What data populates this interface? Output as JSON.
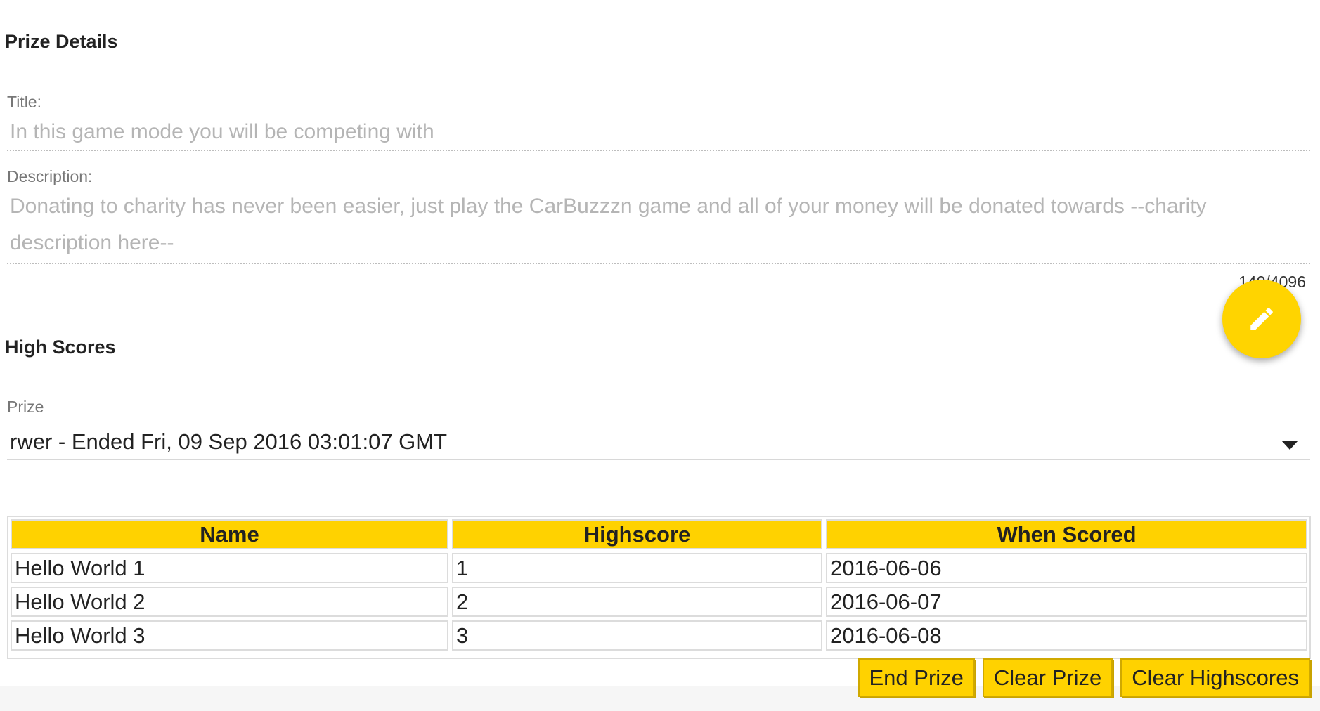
{
  "prize_details": {
    "heading": "Prize Details",
    "title_label": "Title:",
    "title_value": "In this game mode you will be competing with",
    "description_label": "Description:",
    "description_value": "Donating to charity has never been easier, just play the CarBuzzzn game and all of your money will be donated towards --charity description here--",
    "char_counter": "140/4096",
    "edit_icon": "pencil-icon",
    "accent_color": "#ffd400"
  },
  "high_scores": {
    "heading": "High Scores",
    "prize_label": "Prize",
    "prize_selected": "rwer - Ended Fri, 09 Sep 2016 03:01:07 GMT",
    "table": {
      "headers": [
        "Name",
        "Highscore",
        "When Scored"
      ],
      "rows": [
        [
          "Hello World 1",
          "1",
          "2016-06-06"
        ],
        [
          "Hello World 2",
          "2",
          "2016-06-07"
        ],
        [
          "Hello World 3",
          "3",
          "2016-06-08"
        ]
      ]
    },
    "buttons": {
      "end_prize": "End Prize",
      "clear_prize": "Clear Prize",
      "clear_highscores": "Clear Highscores"
    }
  }
}
